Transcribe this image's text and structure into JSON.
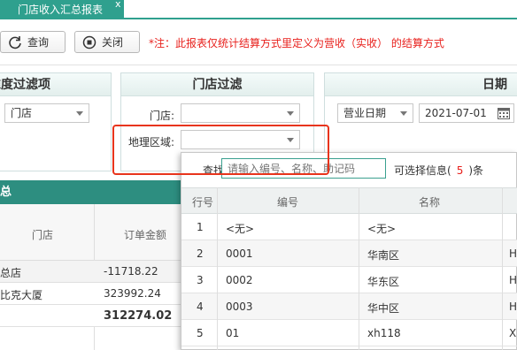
{
  "tab": {
    "title": "门店收入汇总报表",
    "close": "x"
  },
  "toolbar": {
    "query_label": "查询",
    "close_label": "关闭",
    "notice": "*注：此报表仅统计结算方式里定义为营收（实收） 的结算方式"
  },
  "filters": {
    "dimension": {
      "title": "维度过滤项",
      "select_value": "门店"
    },
    "store": {
      "title": "门店过滤",
      "store_label": "门店:",
      "store_value": "",
      "region_label": "地理区域:",
      "region_value": ""
    },
    "date": {
      "title": "日期",
      "type_value": "营业日期",
      "date_value": "2021-07-01"
    }
  },
  "summary": {
    "title": "总",
    "columns": [
      "门店",
      "订单金额"
    ],
    "rows": [
      {
        "store": "总店",
        "amount": "-11718.22"
      },
      {
        "store": "比克大厦",
        "amount": "323992.24"
      }
    ],
    "total": "312274.02"
  },
  "popup": {
    "search_label": "查找:",
    "search_placeholder": "请输入编号、名称、助记码",
    "info_prefix": "可选择信息(",
    "info_count": "5",
    "info_suffix": ")条",
    "columns": [
      "行号",
      "编号",
      "名称"
    ],
    "rows": [
      {
        "no": "1",
        "code": "<无>",
        "name": "<无>",
        "extra": ""
      },
      {
        "no": "2",
        "code": "0001",
        "name": "华南区",
        "extra": "H"
      },
      {
        "no": "3",
        "code": "0002",
        "name": "华东区",
        "extra": "H"
      },
      {
        "no": "4",
        "code": "0003",
        "name": "华中区",
        "extra": "H"
      },
      {
        "no": "5",
        "code": "01",
        "name": "xh118",
        "extra": "X"
      }
    ]
  },
  "colors": {
    "accent": "#2fa08e",
    "header_dark": "#2d8e80",
    "notice": "#e8201c",
    "highlight": "#e8341c"
  }
}
